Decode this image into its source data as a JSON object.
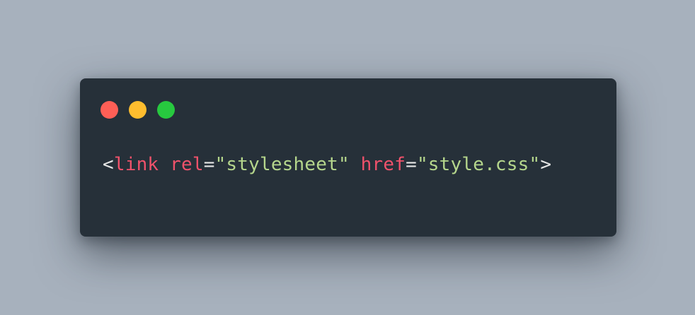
{
  "window_controls": {
    "close_color": "#ff5f56",
    "minimize_color": "#ffbd2e",
    "maximize_color": "#27c93f"
  },
  "code": {
    "open_bracket": "<",
    "tag_name": "link",
    "space_1": " ",
    "attr_1_name": "rel",
    "equals_1": "=",
    "attr_1_value": "\"stylesheet\"",
    "space_2": " ",
    "attr_2_name": "href",
    "equals_2": "=",
    "attr_2_value": "\"style.css\"",
    "close_bracket": ">"
  },
  "syntax_colors": {
    "punctuation": "#e6e6e6",
    "tag": "#f0526b",
    "attribute": "#f0526b",
    "string": "#b5d68c"
  }
}
